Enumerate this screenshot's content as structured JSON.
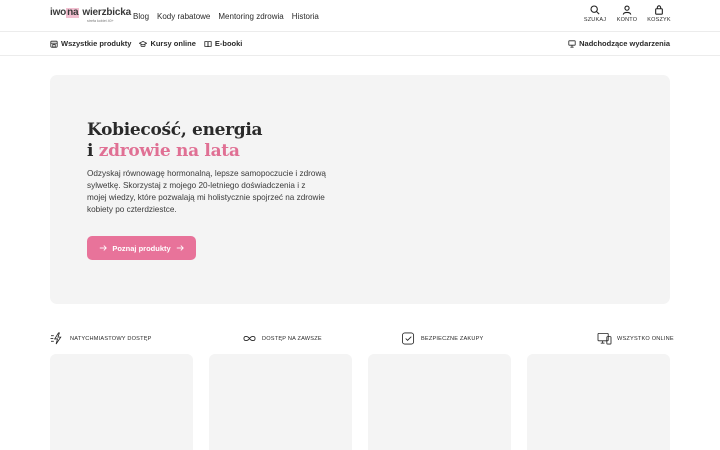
{
  "brand": {
    "first": "iwo",
    "highlight": "na",
    "last": "wierzbicka",
    "tagline": "strefa kobiet 40+"
  },
  "nav": {
    "items": [
      "Blog",
      "Kody rabatowe",
      "Mentoring zdrowia",
      "Historia"
    ]
  },
  "actions": {
    "search": "SZUKAJ",
    "account": "KONTO",
    "cart": "KOSZYK"
  },
  "subnav": {
    "all_products": "Wszystkie produkty",
    "courses": "Kursy online",
    "ebooks": "E-booki",
    "events": "Nadchodzące wydarzenia"
  },
  "hero": {
    "title_line1": "Kobiecość, energia",
    "title_line2_prefix": "i ",
    "title_line2_accent": "zdrowie na lata",
    "description": "Odzyskaj równowagę hormonalną, lepsze samopoczucie i zdrową sylwetkę. Skorzystaj z mojego 20-letniego doświadczenia i z mojej wiedzy, które pozwalają mi holistycznie spojrzeć na zdrowie kobiety po czterdziestce.",
    "cta": "Poznaj produkty"
  },
  "features": {
    "instant": "NATYCHMIASTOWY DOSTĘP",
    "forever": "DOSTĘP NA ZAWSZE",
    "secure": "BEZPIECZNE ZAKUPY",
    "online": "WSZYSTKO ONLINE"
  },
  "colors": {
    "accent": "#e8739a",
    "accent_text": "#e07094",
    "logo_highlight": "#f2bfd0",
    "panel_bg": "#f4f4f4"
  }
}
